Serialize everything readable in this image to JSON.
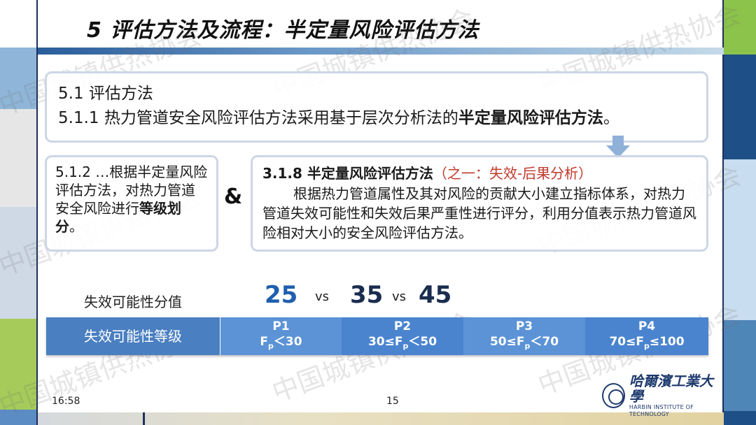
{
  "slide": {
    "title": "5 评估方法及流程：半定量风险评估方法",
    "section": "5.1 评估方法",
    "clause_prefix": "5.1.1 热力管道安全风险评估方法采用基于层次分析法的",
    "clause_bold": "半定量风险评估方法",
    "clause_suffix": "。",
    "left_box_text": "5.1.2 …根据半定量风险评估方法，对热力管道安全风险进行",
    "left_box_bold": "等级划分",
    "left_box_end": "。",
    "amp": "&",
    "right_box_heading": "3.1.8 半定量风险评估方法",
    "right_box_heading_sub": "（之一：失效-后果分析）",
    "right_box_body": "根据热力管道属性及其对风险的贡献大小建立指标体系，对热力管道失效可能性和失效后果严重性进行评分，利用分值表示热力管道风险相对大小的安全风险评估方法。",
    "scores_label": "失效可能性分值",
    "scores": [
      "25",
      "35",
      "45"
    ],
    "vs": "vs",
    "table_head": "失效可能性等级",
    "levels": [
      {
        "name": "P1",
        "range_prefix": "F",
        "range_sub": "p",
        "range_suffix": "＜30",
        "range_pre": ""
      },
      {
        "name": "P2",
        "range_pre": "30≤F",
        "range_sub": "p",
        "range_suffix": "＜50"
      },
      {
        "name": "P3",
        "range_pre": "50≤F",
        "range_sub": "p",
        "range_suffix": "＜70"
      },
      {
        "name": "P4",
        "range_pre": "70≤F",
        "range_sub": "p",
        "range_suffix": "≤100"
      }
    ],
    "time": "16:58",
    "page_number": "15",
    "logo_cn": "哈爾濱工業大學",
    "logo_en": "HARBIN INSTITUTE OF TECHNOLOGY",
    "watermark": "中国城镇供热协会"
  },
  "colors": {
    "score_blue": "#1f5fae",
    "score_dark": "#1a2d4f",
    "table_blue": "#4a84cf",
    "accent_red": "#c0392b"
  }
}
